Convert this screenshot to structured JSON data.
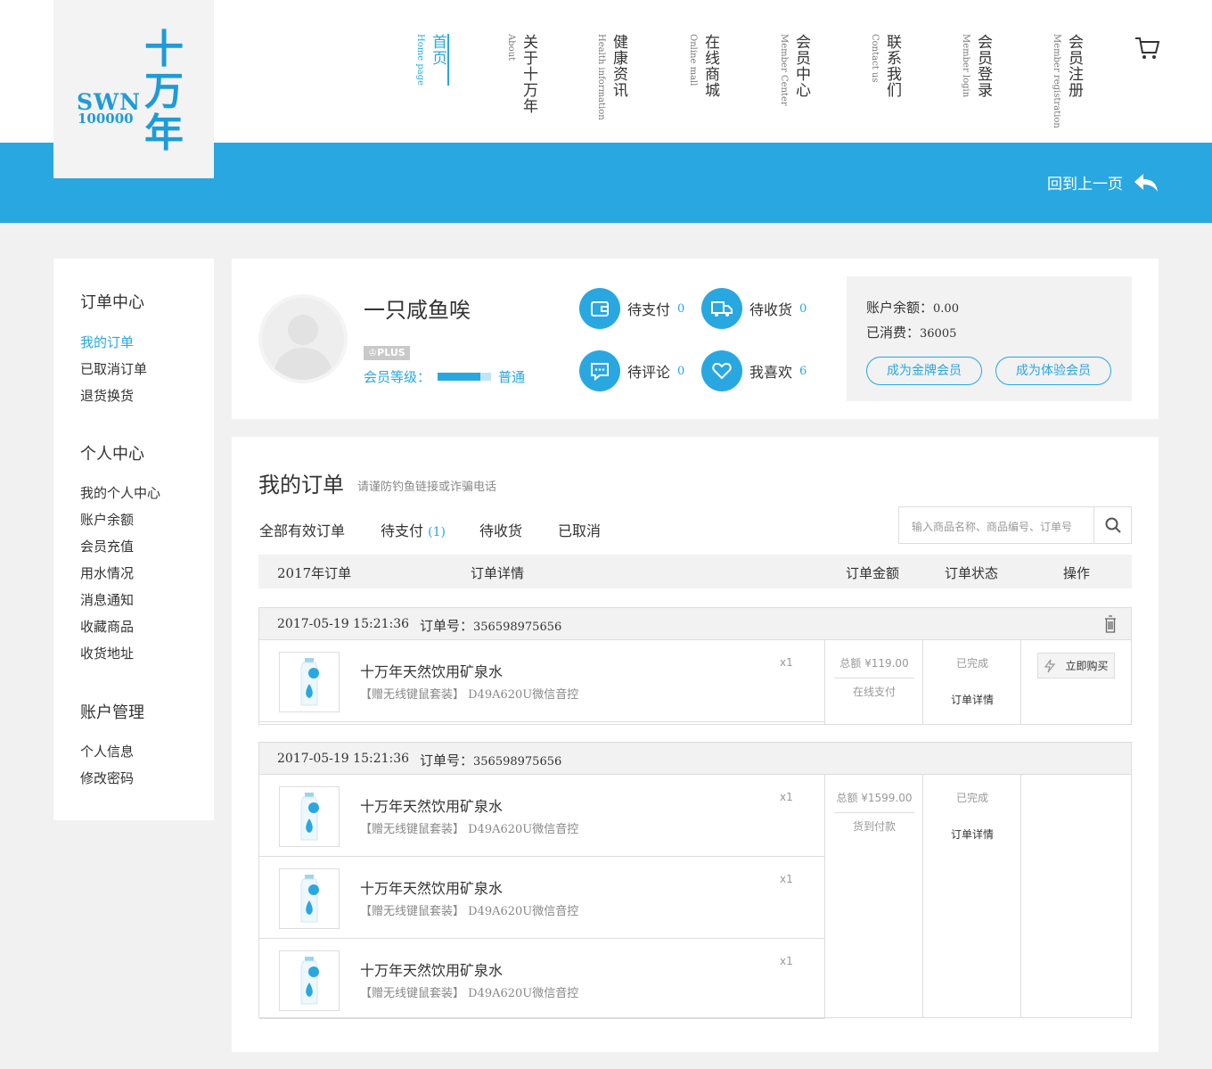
{
  "header": {
    "logo": {
      "latin": "SWN",
      "number": "100000",
      "chinese": "十万年"
    },
    "nav": [
      {
        "cn": "首页",
        "en": "Home page"
      },
      {
        "cn": "关于十万年",
        "en": "About"
      },
      {
        "cn": "健康资讯",
        "en": "Health information"
      },
      {
        "cn": "在线商城",
        "en": "Online mall"
      },
      {
        "cn": "会员中心",
        "en": "Member Center"
      },
      {
        "cn": "联系我们",
        "en": "Contact us"
      },
      {
        "cn": "会员登录",
        "en": "Member login"
      },
      {
        "cn": "会员注册",
        "en": "Member registration"
      }
    ],
    "cart_icon": "cart-icon",
    "back_label": "回到上一页",
    "accent": "#29a7e1"
  },
  "sidebar": {
    "groups": [
      {
        "title": "订单中心",
        "items": [
          "我的订单",
          "已取消订单",
          "退货换货"
        ]
      },
      {
        "title": "个人中心",
        "items": [
          "我的个人中心",
          "账户余额",
          "会员充值",
          "用水情况",
          "消息通知",
          "收藏商品",
          "收货地址"
        ]
      },
      {
        "title": "账户管理",
        "items": [
          "个人信息",
          "修改密码"
        ]
      }
    ]
  },
  "profile": {
    "username": "一只咸鱼唉",
    "badge": "PLUS",
    "level_label": "会员等级：",
    "level_name": "普通",
    "level_progress": 0.8,
    "stats": [
      {
        "label": "待支付",
        "count": "0",
        "icon": "wallet-icon"
      },
      {
        "label": "待收货",
        "count": "0",
        "icon": "truck-icon"
      },
      {
        "label": "待评论",
        "count": "0",
        "icon": "comment-icon"
      },
      {
        "label": "我喜欢",
        "count": "6",
        "icon": "heart-icon"
      }
    ],
    "balance_label": "账户余额：",
    "balance_value": "0.00",
    "spent_label": "已消费：",
    "spent_value": "36005",
    "btn_gold": "成为金牌会员",
    "btn_trial": "成为体验会员"
  },
  "orders": {
    "title": "我的订单",
    "subtitle": "请谨防钓鱼链接或诈骗电话",
    "tabs": [
      {
        "label": "全部有效订单",
        "count": ""
      },
      {
        "label": "待支付",
        "count": "(1)"
      },
      {
        "label": "待收货",
        "count": ""
      },
      {
        "label": "已取消",
        "count": ""
      }
    ],
    "search_placeholder": "输入商品名称、商品编号、订单号",
    "columns": [
      "2017年订单",
      "订单详情",
      "订单金额",
      "订单状态",
      "操作"
    ],
    "list": [
      {
        "date": "2017-05-19  15:21:36",
        "order_label": "订单号：",
        "order_no": "356598975656",
        "items": [
          {
            "name": "十万年天然饮用矿泉水",
            "desc": "【赠无线键鼠套装】 D49A620U微信音控",
            "qty": "x1"
          }
        ],
        "total": "总额 ¥119.00",
        "payment": "在线支付",
        "status": "已完成",
        "detail": "订单详情",
        "action": "立即购买"
      },
      {
        "date": "2017-05-19  15:21:36",
        "order_label": "订单号：",
        "order_no": "356598975656",
        "items": [
          {
            "name": "十万年天然饮用矿泉水",
            "desc": "【赠无线键鼠套装】 D49A620U微信音控",
            "qty": "x1"
          },
          {
            "name": "十万年天然饮用矿泉水",
            "desc": "【赠无线键鼠套装】 D49A620U微信音控",
            "qty": "x1"
          },
          {
            "name": "十万年天然饮用矿泉水",
            "desc": "【赠无线键鼠套装】 D49A620U微信音控",
            "qty": "x1"
          }
        ],
        "total": "总额 ¥1599.00",
        "payment": "货到付款",
        "status": "已完成",
        "detail": "订单详情",
        "action": ""
      }
    ]
  }
}
